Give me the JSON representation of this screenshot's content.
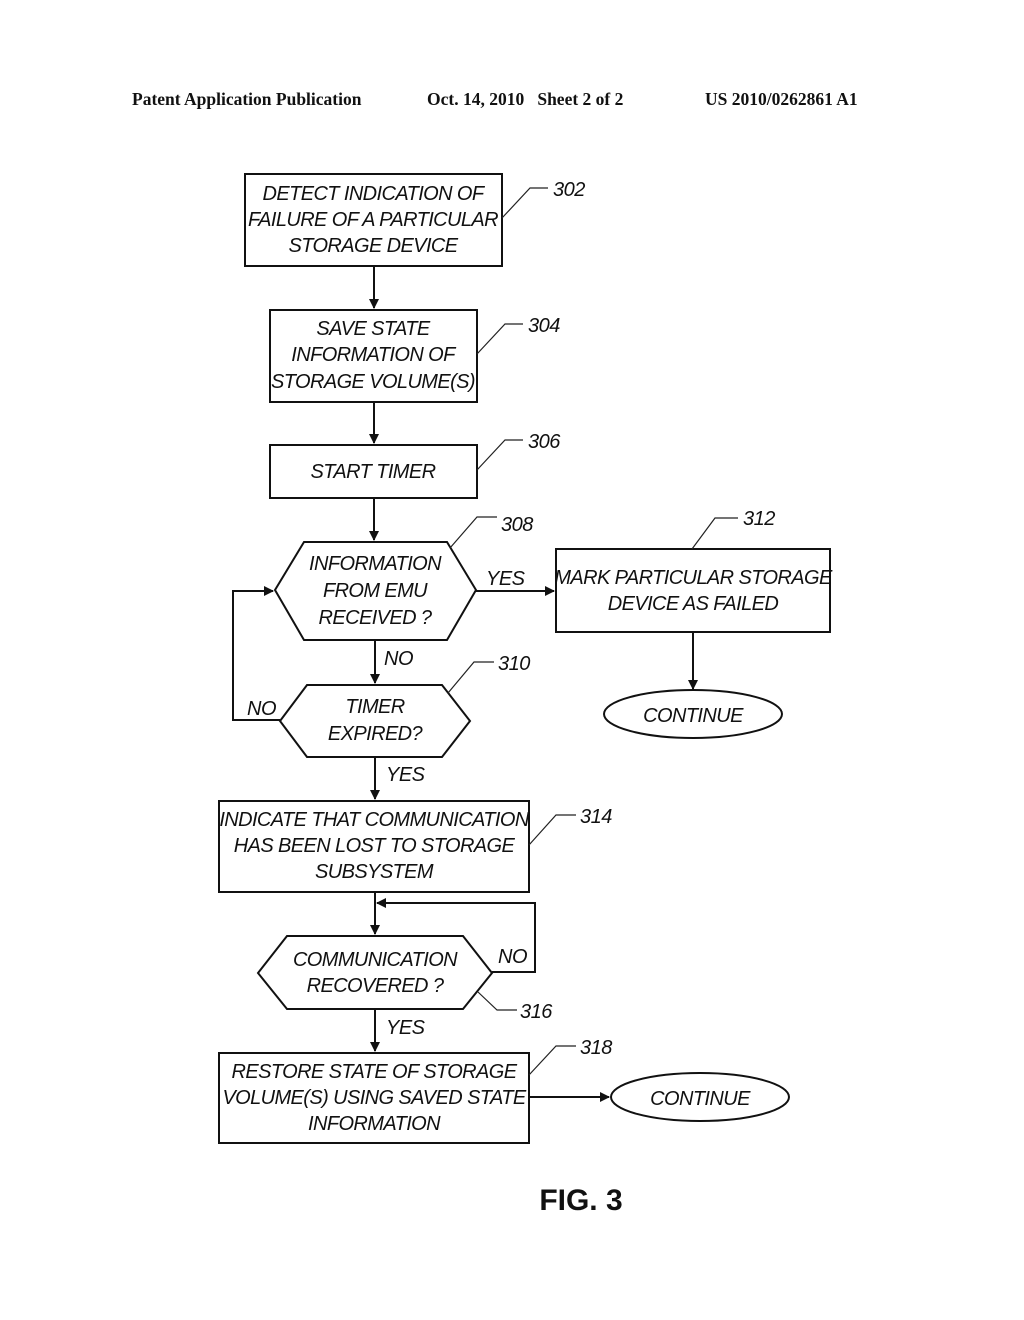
{
  "header": {
    "publication": "Patent Application Publication",
    "date_sheet": "Oct. 14, 2010   Sheet 2 of 2",
    "number": "US 2010/0262861 A1"
  },
  "figure_label": "FIG. 3",
  "nodes": {
    "n302": {
      "ref": "302",
      "lines": [
        "DETECT INDICATION OF",
        "FAILURE OF A PARTICULAR",
        "STORAGE DEVICE"
      ]
    },
    "n304": {
      "ref": "304",
      "lines": [
        "SAVE STATE",
        "INFORMATION OF",
        "STORAGE VOLUME(S)"
      ]
    },
    "n306": {
      "ref": "306",
      "lines": [
        "START TIMER"
      ]
    },
    "n308": {
      "ref": "308",
      "lines": [
        "INFORMATION",
        "FROM EMU",
        "RECEIVED ?"
      ]
    },
    "n310": {
      "ref": "310",
      "lines": [
        "TIMER",
        "EXPIRED?"
      ]
    },
    "n312": {
      "ref": "312",
      "lines": [
        "MARK PARTICULAR STORAGE",
        "DEVICE AS FAILED"
      ]
    },
    "n314": {
      "ref": "314",
      "lines": [
        "INDICATE THAT COMMUNICATION",
        "HAS BEEN LOST TO STORAGE",
        "SUBSYSTEM"
      ]
    },
    "n316": {
      "ref": "316",
      "lines": [
        "COMMUNICATION",
        "RECOVERED ?"
      ]
    },
    "n318": {
      "ref": "318",
      "lines": [
        "RESTORE STATE OF STORAGE",
        "VOLUME(S) USING SAVED STATE",
        "INFORMATION"
      ]
    },
    "continue1": {
      "lines": [
        "CONTINUE"
      ]
    },
    "continue2": {
      "lines": [
        "CONTINUE"
      ]
    }
  },
  "edge_labels": {
    "e308_yes": "YES",
    "e308_no": "NO",
    "e310_no": "NO",
    "e310_yes": "YES",
    "e316_no": "NO",
    "e316_yes": "YES"
  }
}
